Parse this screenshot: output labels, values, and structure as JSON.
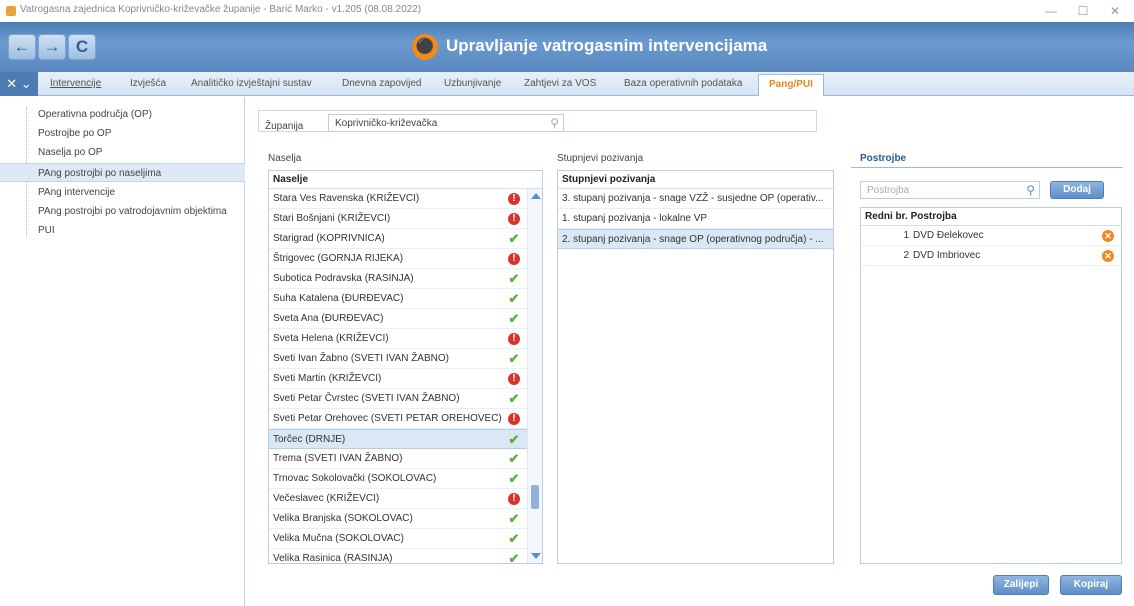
{
  "window": {
    "title": "Vatrogasna zajednica Koprivničko-križevačke županije - Barić Marko - v1.205 (08.08.2022)",
    "minimize": "—",
    "maximize": "☐",
    "close": "✕"
  },
  "header": {
    "back": "←",
    "forward": "→",
    "refresh": "C",
    "app_title": "Upravljanje vatrogasnim intervencijama"
  },
  "menu": {
    "tools": "✕ ⌄",
    "items": [
      "Intervencije",
      "Izvješća",
      "Analitičko izvještajni sustav",
      "Dnevna zapovijed",
      "Uzbunjivanje",
      "Zahtjevi za VOS",
      "Baza operativnih podataka",
      "Pang/PUI"
    ]
  },
  "sidebar": {
    "items": [
      "Operativna područja (OP)",
      "Postrojbe po OP",
      "Naselja po OP",
      "PAng postrojbi po naseljima",
      "PAng intervencije",
      "PAng postrojbi po vatrodojavnim objektima",
      "PUI"
    ]
  },
  "filter": {
    "label": "Županija",
    "value": "Koprivničko-križevačka"
  },
  "naselja": {
    "title": "Naselja",
    "header": "Naselje",
    "rows": [
      {
        "name": "Stara Ves Ravenska (KRIŽEVCI)",
        "status": "bad"
      },
      {
        "name": "Stari Bošnjani (KRIŽEVCI)",
        "status": "bad"
      },
      {
        "name": "Starigrad (KOPRIVNICA)",
        "status": "ok"
      },
      {
        "name": "Štrigovec (GORNJA RIJEKA)",
        "status": "bad"
      },
      {
        "name": "Subotica Podravska (RASINJA)",
        "status": "ok"
      },
      {
        "name": "Suha Katalena (ĐURĐEVAC)",
        "status": "ok"
      },
      {
        "name": "Sveta Ana (ĐURĐEVAC)",
        "status": "ok"
      },
      {
        "name": "Sveta Helena (KRIŽEVCI)",
        "status": "bad"
      },
      {
        "name": "Sveti Ivan Žabno (SVETI IVAN ŽABNO)",
        "status": "ok"
      },
      {
        "name": "Sveti Martin (KRIŽEVCI)",
        "status": "bad"
      },
      {
        "name": "Sveti Petar Čvrstec (SVETI IVAN ŽABNO)",
        "status": "ok"
      },
      {
        "name": "Sveti Petar Orehovec (SVETI PETAR OREHOVEC)",
        "status": "bad"
      },
      {
        "name": "Torčec (DRNJE)",
        "status": "ok",
        "selected": true
      },
      {
        "name": "Trema (SVETI IVAN ŽABNO)",
        "status": "ok"
      },
      {
        "name": "Trnovac Sokolovački (SOKOLOVAC)",
        "status": "ok"
      },
      {
        "name": "Večeslavec (KRIŽEVCI)",
        "status": "bad"
      },
      {
        "name": "Velika Branjska (SOKOLOVAC)",
        "status": "ok"
      },
      {
        "name": "Velika Mučna (SOKOLOVAC)",
        "status": "ok"
      },
      {
        "name": "Velika Rasinica (RASINJA)",
        "status": "ok"
      }
    ],
    "status_bad_glyph": "!",
    "status_ok_glyph": "✔"
  },
  "stupnjevi": {
    "title": "Stupnjevi pozivanja",
    "header": "Stupnjevi pozivanja",
    "rows": [
      {
        "text": "3. stupanj pozivanja - snage VZŽ - susjedne OP (operativ..."
      },
      {
        "text": "1. stupanj pozivanja - lokalne VP"
      },
      {
        "text": "2. stupanj pozivanja - snage OP (operativnog područja) - ...",
        "selected": true
      }
    ]
  },
  "postrojbe": {
    "title": "Postrojbe",
    "search_placeholder": "Postrojba",
    "add_label": "Dodaj",
    "col_num": "Redni br.",
    "col_name": "Postrojba",
    "rows": [
      {
        "num": "1",
        "name": "DVD Đelekovec"
      },
      {
        "num": "2",
        "name": "DVD Imbriovec"
      }
    ],
    "remove_glyph": "✕"
  },
  "actions": {
    "paste_label": "Zalijepi",
    "copy_label": "Kopiraj"
  },
  "colors": {
    "header_blue": "#5a88bf",
    "accent_orange": "#f28a1a",
    "status_bad": "#d9322b",
    "status_ok": "#5fae3a"
  }
}
